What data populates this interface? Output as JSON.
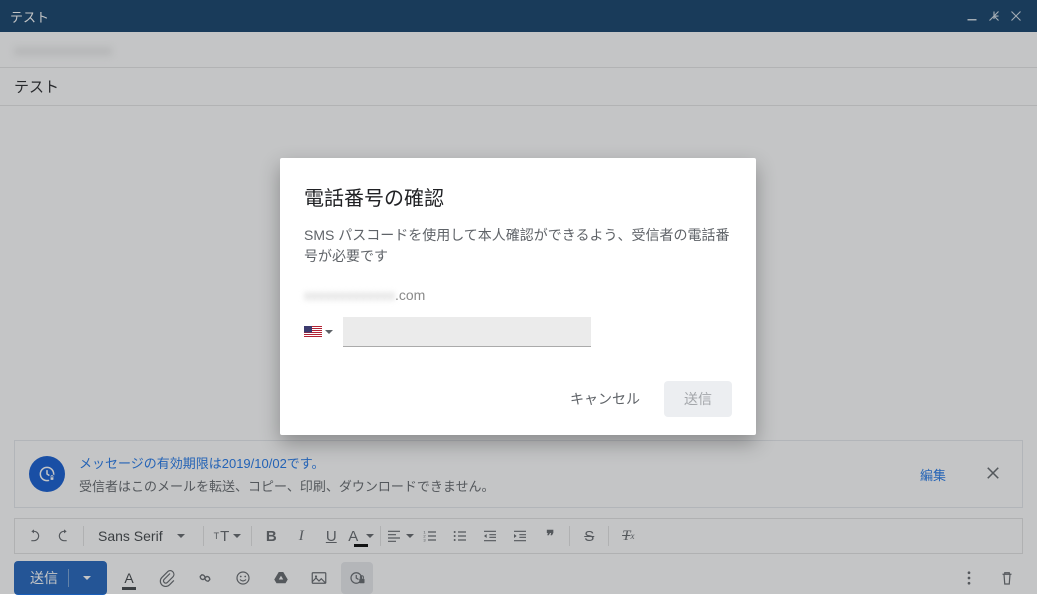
{
  "titlebar": {
    "title": "テスト"
  },
  "subject": "テスト",
  "recipient_blurred": "xxxxxxxxxxxxxx",
  "confidential": {
    "line1": "メッセージの有効期限は2019/10/02です。",
    "line2": "受信者はこのメールを転送、コピー、印刷、ダウンロードできません。",
    "edit_label": "編集"
  },
  "format": {
    "font_name": "Sans Serif"
  },
  "send_button": "送信",
  "dialog": {
    "title": "電話番号の確認",
    "description": "SMS パスコードを使用して本人確認ができるよう、受信者の電話番号が必要です",
    "email_blurred": "xxxxxxxxxxxxx",
    "email_suffix": ".com",
    "cancel_label": "キャンセル",
    "send_label": "送信"
  }
}
